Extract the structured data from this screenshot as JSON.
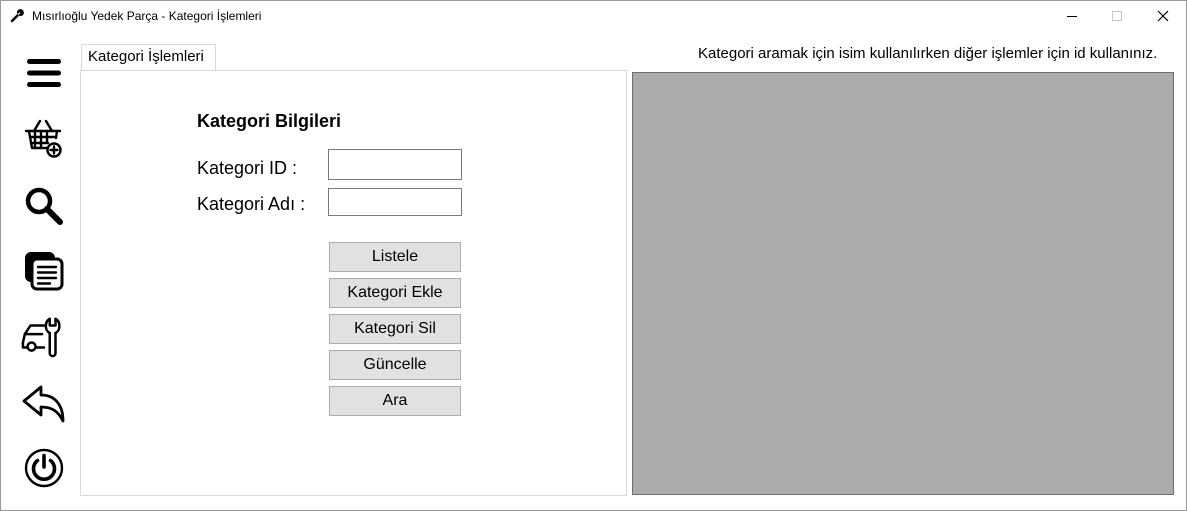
{
  "window": {
    "title": "Mısırlıoğlu Yedek Parça - Kategori İşlemleri",
    "app_icon": "wrench-icon"
  },
  "sidebar": {
    "items": [
      {
        "icon": "menu-icon"
      },
      {
        "icon": "basket-add-icon"
      },
      {
        "icon": "search-icon"
      },
      {
        "icon": "documents-icon"
      },
      {
        "icon": "car-wrench-icon"
      },
      {
        "icon": "back-arrow-icon"
      },
      {
        "icon": "power-icon"
      }
    ]
  },
  "tab": {
    "label": "Kategori İşlemleri"
  },
  "form": {
    "heading": "Kategori Bilgileri",
    "id_label": "Kategori ID :",
    "id_value": "",
    "name_label": "Kategori Adı :",
    "name_value": ""
  },
  "buttons": {
    "list": "Listele",
    "add": "Kategori Ekle",
    "delete": "Kategori Sil",
    "update": "Güncelle",
    "search": "Ara"
  },
  "hint": "Kategori aramak için isim kullanılırken diğer işlemler için id kullanınız."
}
